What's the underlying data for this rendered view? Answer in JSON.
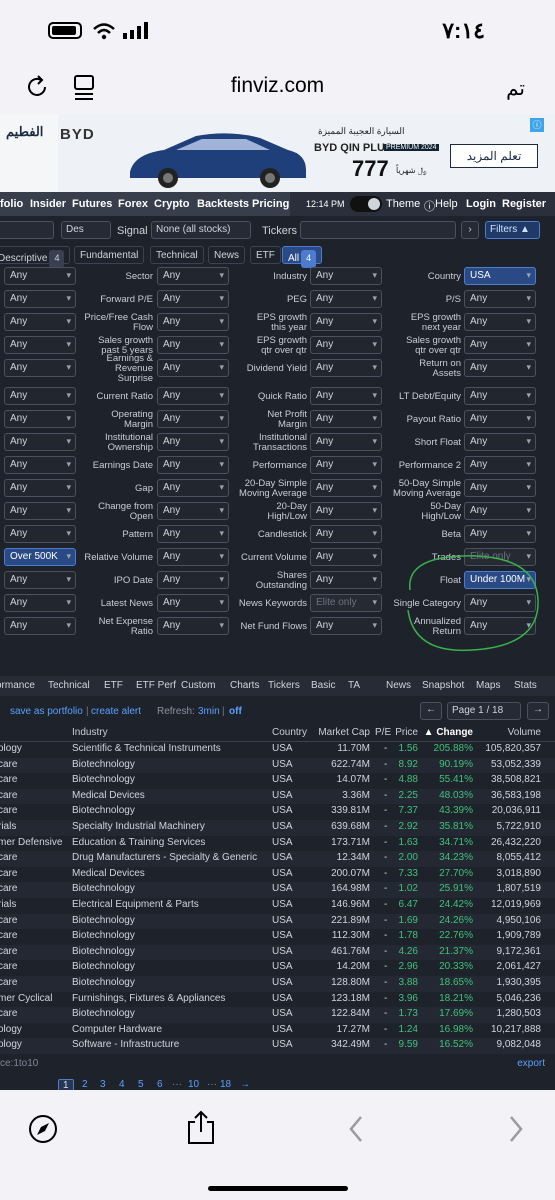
{
  "status": {
    "time": "٧:١٤"
  },
  "browser": {
    "url": "finviz.com",
    "done": "تم"
  },
  "ad": {
    "headline": "السيارة العجيبة المميزة",
    "brand": "BYD QIN PLUS",
    "model": "PREMIUM 2024",
    "price": "777",
    "currency": "﷼ شهرياً",
    "cta": "تعلم المزيد",
    "logo": "BYD",
    "dealer": "الفطيم"
  },
  "nav": {
    "items": [
      "folio",
      "Insider",
      "Futures",
      "Forex",
      "Crypto",
      "Backtests",
      "Pricing"
    ],
    "time": "12:14 PM",
    "theme": "Theme",
    "help": "Help",
    "login": "Login",
    "register": "Register"
  },
  "toolbar": {
    "order": "Des",
    "signal_label": "Signal",
    "signal_value": "None (all stocks)",
    "tickers_label": "Tickers",
    "filters": "Filters ▲"
  },
  "filter_tabs": {
    "descriptive": "Descriptive",
    "descriptive_count": "4",
    "fundamental": "Fundamental",
    "technical": "Technical",
    "news": "News",
    "etf": "ETF",
    "all": "All",
    "all_count": "4"
  },
  "filters": [
    {
      "c1v": "Any",
      "l2": "Sector",
      "c2v": "Any",
      "l3": "Industry",
      "c3v": "Any",
      "l4": "Country",
      "c4v": "USA"
    },
    {
      "c1v": "Any",
      "l2": "Forward P/E",
      "c2v": "Any",
      "l3": "PEG",
      "c3v": "Any",
      "l4": "P/S",
      "c4v": "Any"
    },
    {
      "c1v": "Any",
      "l2": "Price/Free Cash\nFlow",
      "c2v": "Any",
      "l3": "EPS growth\nthis year",
      "c3v": "Any",
      "l4": "EPS growth\nnext year",
      "c4v": "Any"
    },
    {
      "c1v": "Any",
      "l2": "Sales growth\npast 5 years",
      "c2v": "Any",
      "l3": "EPS growth\nqtr over qtr",
      "c3v": "Any",
      "l4": "Sales growth\nqtr over qtr",
      "c4v": "Any"
    },
    {
      "c1v": "Any",
      "l2": "Earnings &\nRevenue\nSurprise",
      "c2v": "Any",
      "l3": "Dividend Yield",
      "c3v": "Any",
      "l4": "Return on\nAssets",
      "c4v": "Any"
    },
    {
      "c1v": "Any",
      "l2": "Current Ratio",
      "c2v": "Any",
      "l3": "Quick Ratio",
      "c3v": "Any",
      "l4": "LT Debt/Equity",
      "c4v": "Any"
    },
    {
      "c1v": "Any",
      "l2": "Operating\nMargin",
      "c2v": "Any",
      "l3": "Net Profit\nMargin",
      "c3v": "Any",
      "l4": "Payout Ratio",
      "c4v": "Any"
    },
    {
      "c1v": "Any",
      "l2": "Institutional\nOwnership",
      "c2v": "Any",
      "l3": "Institutional\nTransactions",
      "c3v": "Any",
      "l4": "Short Float",
      "c4v": "Any"
    },
    {
      "c1v": "Any",
      "l2": "Earnings Date",
      "c2v": "Any",
      "l3": "Performance",
      "c3v": "Any",
      "l4": "Performance 2",
      "c4v": "Any"
    },
    {
      "c1v": "Any",
      "l2": "Gap",
      "c2v": "Any",
      "l3": "20-Day Simple\nMoving Average",
      "c3v": "Any",
      "l4": "50-Day Simple\nMoving Average",
      "c4v": "Any"
    },
    {
      "c1v": "Any",
      "l2": "Change from\nOpen",
      "c2v": "Any",
      "l3": "20-Day\nHigh/Low",
      "c3v": "Any",
      "l4": "50-Day\nHigh/Low",
      "c4v": "Any"
    },
    {
      "c1v": "Any",
      "l2": "Pattern",
      "c2v": "Any",
      "l3": "Candlestick",
      "c3v": "Any",
      "l4": "Beta",
      "c4v": "Any"
    },
    {
      "c1v": "Over 500K",
      "l2": "Relative Volume",
      "c2v": "Any",
      "l3": "Current Volume",
      "c3v": "Any",
      "l4": "Trades",
      "c4v": "Elite only"
    },
    {
      "c1v": "Any",
      "l2": "IPO Date",
      "c2v": "Any",
      "l3": "Shares\nOutstanding",
      "c3v": "Any",
      "l4": "Float",
      "c4v": "Under 100M"
    },
    {
      "c1v": "Any",
      "l2": "Latest News",
      "c2v": "Any",
      "l3": "News Keywords",
      "c3v": "Elite only",
      "l4": "Single Category",
      "c4v": "Any"
    },
    {
      "c1v": "Any",
      "l2": "Net Expense\nRatio",
      "c2v": "Any",
      "l3": "Net Fund Flows",
      "c3v": "Any",
      "l4": "Annualized\nReturn",
      "c4v": "Any"
    }
  ],
  "view_tabs": [
    "ormance",
    "Technical",
    "ETF",
    "ETF Perf",
    "Custom",
    "Charts",
    "Tickers",
    "Basic",
    "TA",
    "News",
    "Snapshot",
    "Maps",
    "Stats"
  ],
  "results_toolbar": {
    "save": "save as portfolio",
    "alert": "create alert",
    "refresh_label": "Refresh:",
    "refresh_value": "3min",
    "off": "off",
    "page": "Page 1 / 18"
  },
  "table": {
    "headers": [
      "Industry",
      "Country",
      "Market Cap",
      "P/E",
      "Price",
      "▲ Change",
      "Volume"
    ],
    "rows": [
      [
        "ology",
        "Scientific & Technical Instruments",
        "USA",
        "11.70M",
        "-",
        "1.56",
        "205.88%",
        "105,820,357"
      ],
      [
        "care",
        "Biotechnology",
        "USA",
        "622.74M",
        "-",
        "8.92",
        "90.19%",
        "53,052,339"
      ],
      [
        "care",
        "Biotechnology",
        "USA",
        "14.07M",
        "-",
        "4.88",
        "55.41%",
        "38,508,821"
      ],
      [
        "care",
        "Medical Devices",
        "USA",
        "3.36M",
        "-",
        "2.25",
        "48.03%",
        "36,583,198"
      ],
      [
        "care",
        "Biotechnology",
        "USA",
        "339.81M",
        "-",
        "7.37",
        "43.39%",
        "20,036,911"
      ],
      [
        "rials",
        "Specialty Industrial Machinery",
        "USA",
        "639.68M",
        "-",
        "2.92",
        "35.81%",
        "5,722,910"
      ],
      [
        "mer Defensive",
        "Education & Training Services",
        "USA",
        "173.71M",
        "-",
        "1.63",
        "34.71%",
        "26,432,220"
      ],
      [
        "care",
        "Drug Manufacturers - Specialty & Generic",
        "USA",
        "12.34M",
        "-",
        "2.00",
        "34.23%",
        "8,055,412"
      ],
      [
        "care",
        "Medical Devices",
        "USA",
        "200.07M",
        "-",
        "7.33",
        "27.70%",
        "3,018,890"
      ],
      [
        "care",
        "Biotechnology",
        "USA",
        "164.98M",
        "-",
        "1.02",
        "25.91%",
        "1,807,519"
      ],
      [
        "rials",
        "Electrical Equipment & Parts",
        "USA",
        "146.96M",
        "-",
        "6.47",
        "24.42%",
        "12,019,969"
      ],
      [
        "care",
        "Biotechnology",
        "USA",
        "221.89M",
        "-",
        "1.69",
        "24.26%",
        "4,950,106"
      ],
      [
        "care",
        "Biotechnology",
        "USA",
        "112.30M",
        "-",
        "1.78",
        "22.76%",
        "1,909,789"
      ],
      [
        "care",
        "Biotechnology",
        "USA",
        "461.76M",
        "-",
        "4.26",
        "21.37%",
        "9,172,361"
      ],
      [
        "care",
        "Biotechnology",
        "USA",
        "14.20M",
        "-",
        "2.96",
        "20.33%",
        "2,061,427"
      ],
      [
        "care",
        "Biotechnology",
        "USA",
        "128.80M",
        "-",
        "3.88",
        "18.65%",
        "1,930,395"
      ],
      [
        "mer Cyclical",
        "Furnishings, Fixtures & Appliances",
        "USA",
        "123.18M",
        "-",
        "3.96",
        "18.21%",
        "5,046,236"
      ],
      [
        "care",
        "Biotechnology",
        "USA",
        "122.84M",
        "-",
        "1.73",
        "17.69%",
        "1,280,503"
      ],
      [
        "ology",
        "Computer Hardware",
        "USA",
        "17.27M",
        "-",
        "1.24",
        "16.98%",
        "10,217,888"
      ],
      [
        "ology",
        "Software - Infrastructure",
        "USA",
        "342.49M",
        "-",
        "9.59",
        "16.52%",
        "9,082,048"
      ]
    ]
  },
  "footer": {
    "note": "ce:1to10",
    "export": "export",
    "pages": [
      "1",
      "2",
      "3",
      "4",
      "5",
      "6",
      "···",
      "10",
      "···",
      "18",
      "→"
    ]
  }
}
